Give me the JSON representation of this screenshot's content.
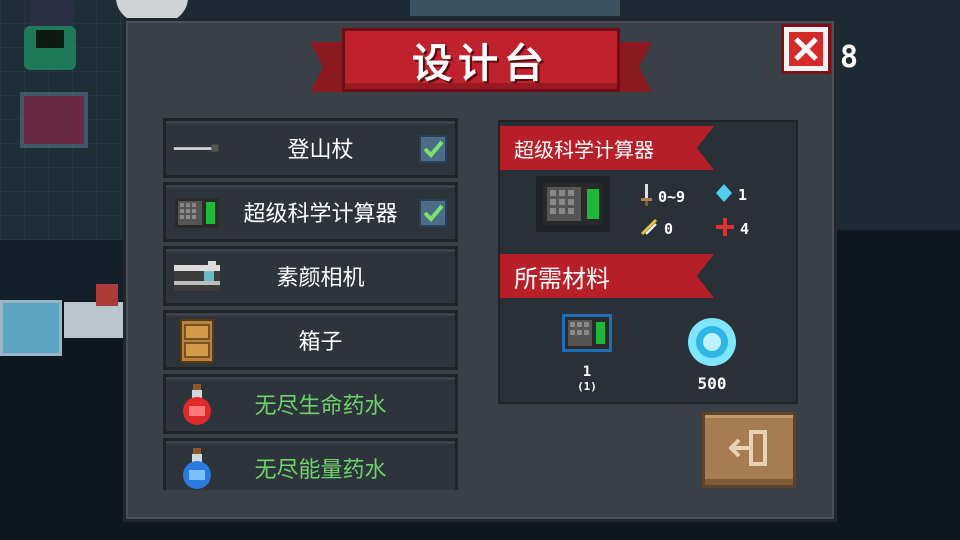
{
  "title": "设计台",
  "corner_counter": "8",
  "items": [
    {
      "label": "登山杖",
      "icon": "walking-stick-icon",
      "checked": true,
      "color": "#ffffff"
    },
    {
      "label": "超级科学计算器",
      "icon": "calculator-icon",
      "checked": true,
      "color": "#ffffff"
    },
    {
      "label": "素颜相机",
      "icon": "camera-icon",
      "checked": false,
      "color": "#ffffff"
    },
    {
      "label": "箱子",
      "icon": "box-icon",
      "checked": false,
      "color": "#ffffff"
    },
    {
      "label": "无尽生命药水",
      "icon": "red-potion-icon",
      "checked": false,
      "color": "#6ed36a"
    },
    {
      "label": "无尽能量药水",
      "icon": "blue-potion-icon",
      "checked": false,
      "color": "#6ed36a"
    }
  ],
  "detail": {
    "name": "超级科学计算器",
    "stats": {
      "damage": "0~9",
      "energy": "1",
      "crit": "0",
      "spread": "4"
    },
    "materials_label": "所需材料",
    "materials": [
      {
        "icon": "calculator-icon",
        "count": "1",
        "owned": "(1)"
      },
      {
        "icon": "gem-icon",
        "count": "500"
      }
    ]
  },
  "colors": {
    "ribbon_red": "#c0222d",
    "panel": "#3a4048",
    "green_text": "#6ed36a",
    "exit_button": "#a67c52"
  }
}
